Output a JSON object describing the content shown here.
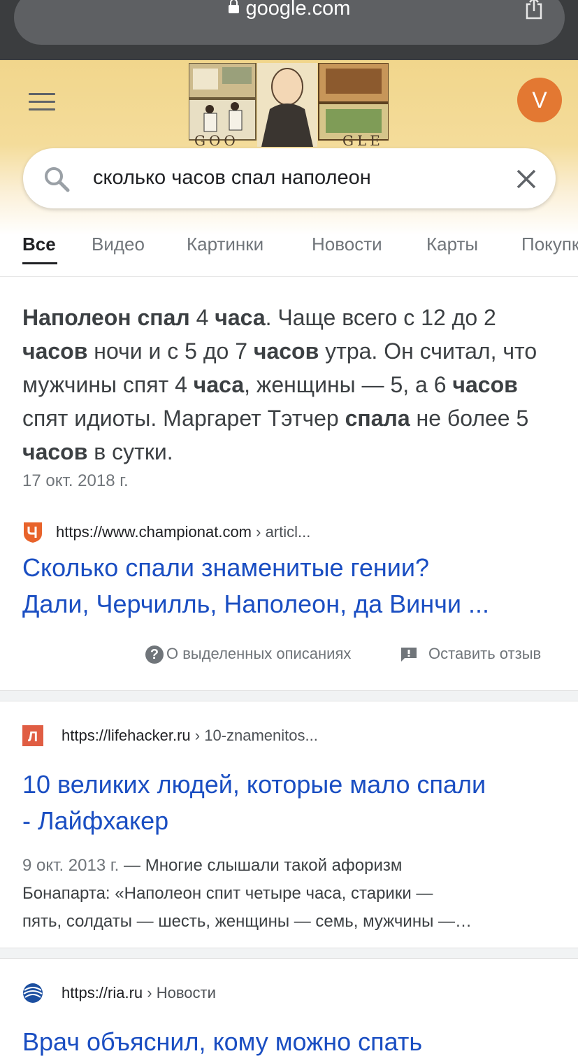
{
  "browser": {
    "url": "google.com"
  },
  "header": {
    "doodle_letters_left": "GOO",
    "doodle_letters_right": "GLE",
    "avatar_letter": "V"
  },
  "search": {
    "query": "сколько часов спал наполеон"
  },
  "tabs": [
    {
      "label": "Все",
      "active": true
    },
    {
      "label": "Видео"
    },
    {
      "label": "Картинки"
    },
    {
      "label": "Новости"
    },
    {
      "label": "Карты"
    },
    {
      "label": "Покупки"
    }
  ],
  "featured": {
    "text_parts": [
      {
        "t": "Наполеон спал",
        "b": true
      },
      {
        "t": " 4 "
      },
      {
        "t": "часа",
        "b": true
      },
      {
        "t": ". Чаще всего с 12 до 2 "
      },
      {
        "t": "часов",
        "b": true
      },
      {
        "t": " ночи и с 5 до 7 "
      },
      {
        "t": "часов",
        "b": true
      },
      {
        "t": " утра. Он считал, что мужчины спят 4 "
      },
      {
        "t": "часа",
        "b": true
      },
      {
        "t": ", женщины — 5, а 6 "
      },
      {
        "t": "часов",
        "b": true
      },
      {
        "t": " спят идиоты. Маргарет Тэтчер "
      },
      {
        "t": "спала",
        "b": true
      },
      {
        "t": " не более 5 "
      },
      {
        "t": "часов",
        "b": true
      },
      {
        "t": " в сутки."
      }
    ],
    "date": "17 окт. 2018 г.",
    "source_url": "https://www.championat.com",
    "source_crumb": " › articl...",
    "title_line1": "Сколько спали знаменитые гении?",
    "title_line2": "Дали, Черчилль, Наполеон, да Винчи ...",
    "about_label": "О выделенных описаниях",
    "feedback_label": "Оставить отзыв",
    "help_glyph": "?"
  },
  "result2": {
    "favicon_letter": "Л",
    "source_url": "https://lifehacker.ru",
    "source_crumb": " › 10-znamenitos...",
    "title_line1": "10 великих людей, которые мало спали",
    "title_line2": "- Лайфхакер",
    "date": "9 окт. 2013 г.",
    "line1_rest": " — Многие слышали такой афоризм",
    "line2": "Бонапарта: «Наполеон спит четыре часа, старики —",
    "line3": "пять, солдаты — шесть, женщины — семь, мужчины —…"
  },
  "result3": {
    "source_url": "https://ria.ru",
    "source_crumb": " › Новости",
    "title_line1": "Врач объяснил, кому можно спать"
  },
  "colors": {
    "link": "#1a4ec2",
    "avatar": "#e37832",
    "championat": "#e8632b",
    "lifehacker": "#e05d43",
    "ria": "#1c4fa0"
  }
}
